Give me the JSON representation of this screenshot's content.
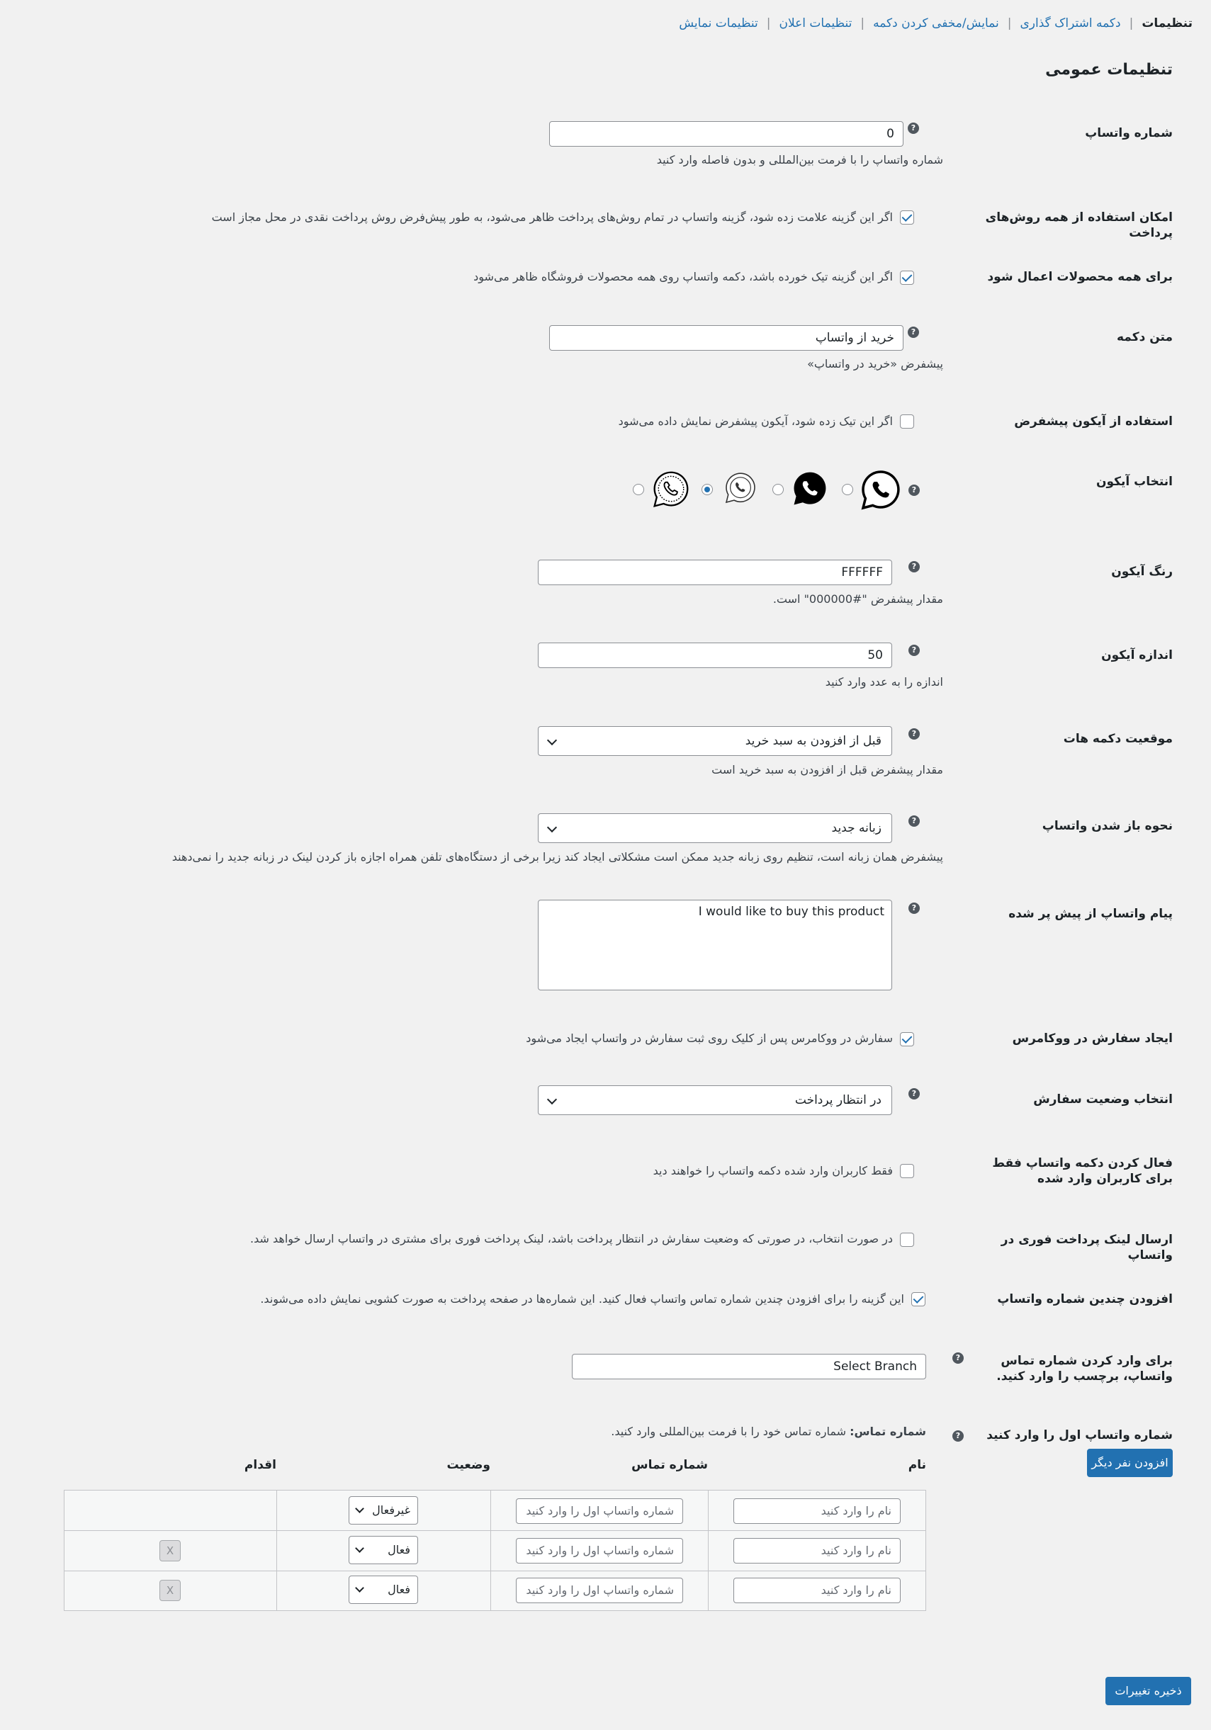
{
  "nav": {
    "current": "تنظیمات",
    "links": [
      "دکمه اشتراک گذاری",
      "نمایش/مخفی کردن دکمه",
      "تنظیمات اعلان",
      "تنظیمات نمایش"
    ]
  },
  "page_title": "تنظیمات عمومی",
  "help_glyph": "?",
  "fields": {
    "whatsapp_number": {
      "label": "شماره واتساپ",
      "value": "0",
      "desc": "شماره واتساپ را با فرمت بین‌المللی و بدون فاصله وارد کنید"
    },
    "all_payment_methods": {
      "label": "امکان استفاده از همه روش‌های پرداخت",
      "checked": true,
      "desc": "اگر این گزینه علامت زده شود، گزینه واتساپ در تمام روش‌های پرداخت ظاهر می‌شود، به طور پیش‌فرض روش پرداخت نقدی در محل مجاز است"
    },
    "all_products": {
      "label": "برای همه محصولات اعمال شود",
      "checked": true,
      "desc": "اگر این گزینه تیک خورده باشد، دکمه واتساپ روی همه محصولات فروشگاه ظاهر می‌شود"
    },
    "button_text": {
      "label": "متن دکمه",
      "value": "خرید از واتساپ",
      "desc": "پیشفرض «خرید در واتساپ»"
    },
    "default_icon": {
      "label": "استفاده از آیکون پیشفرض",
      "checked": false,
      "desc": "اگر این تیک زده شود، آیکون پیشفرض نمایش داده می‌شود"
    },
    "icon_select": {
      "label": "انتخاب آیکون",
      "icons": [
        "whatsapp-outline-icon",
        "whatsapp-solid-icon",
        "whatsapp-thin-icon",
        "whatsapp-dotted-icon"
      ],
      "selected_index": 2
    },
    "icon_color": {
      "label": "رنگ آیکون",
      "value": "FFFFFF",
      "desc": "مقدار پیشفرض \"#000000\" است."
    },
    "icon_size": {
      "label": "اندازه آیکون",
      "value": "50",
      "desc": "اندازه را به عدد وارد کنید"
    },
    "button_position": {
      "label": "موقعیت دکمه هات",
      "value": "قبل از افزودن به سبد خرید",
      "desc": "مقدار پیشفرض قبل از افزودن به سبد خرید است"
    },
    "open_mode": {
      "label": "نحوه باز شدن واتساپ",
      "value": "زبانه جدید",
      "desc": "پیشفرض همان زبانه است، تنظیم روی زبانه جدید ممکن است مشکلاتی ایجاد کند زیرا برخی از دستگاه‌های تلفن همراه اجازه باز کردن لینک در زبانه جدید را نمی‌دهند"
    },
    "prefilled_message": {
      "label": "پیام واتساپ از پیش پر شده",
      "value": "I would like to buy this product"
    },
    "create_order": {
      "label": "ایجاد سفارش در ووکامرس",
      "checked": true,
      "desc": "سفارش در ووکامرس پس از کلیک روی ثبت سفارش در واتساپ ایجاد می‌شود"
    },
    "order_status": {
      "label": "انتخاب وضعیت سفارش",
      "value": "در انتظار پرداخت"
    },
    "logged_in_only": {
      "label": "فعال کردن دکمه واتساپ فقط برای کاربران وارد شده",
      "checked": false,
      "desc": "فقط کاربران وارد شده دکمه واتساپ را خواهند دید"
    },
    "instant_payment_link": {
      "label": "ارسال لینک پرداخت فوری در واتساپ",
      "checked": false,
      "desc": "در صورت انتخاب، در صورتی که وضعیت سفارش در انتظار پرداخت باشد، لینک پرداخت فوری برای مشتری در واتساپ ارسال خواهد شد."
    },
    "multiple_numbers": {
      "label": "افزودن چندین شماره واتساپ",
      "checked": true,
      "desc": "این گزینه را برای افزودن چندین شماره تماس واتساپ فعال کنید. این شماره‌ها در صفحه پرداخت به صورت کشویی نمایش داده می‌شوند."
    },
    "branch_label": {
      "label": "برای وارد کردن شماره تماس واتساپ، برچسب را وارد کنید.",
      "value": "Select Branch"
    },
    "first_number": {
      "label": "شماره واتساپ اول را وارد کنید",
      "desc_bold": "شماره تماس:",
      "desc": " شماره تماس خود را با فرمت بین‌المللی وارد کنید."
    }
  },
  "add_person_button": "افزودن نفر دیگر",
  "table": {
    "headers": {
      "name": "نام",
      "phone": "شماره تماس",
      "status": "وضعیت",
      "action": "اقدام"
    },
    "rows": [
      {
        "name_placeholder": "نام را وارد کنید",
        "phone_placeholder": "شماره واتساپ اول را وارد کنید",
        "status": "غیرفعال",
        "remove": ""
      },
      {
        "name_placeholder": "نام را وارد کنید",
        "phone_placeholder": "شماره واتساپ اول را وارد کنید",
        "status": "فعال",
        "remove": "X"
      },
      {
        "name_placeholder": "نام را وارد کنید",
        "phone_placeholder": "شماره واتساپ اول را وارد کنید",
        "status": "فعال",
        "remove": "X"
      }
    ]
  },
  "save_button": "ذخیره تغییرات",
  "colors": {
    "accent": "#2271b1",
    "background": "#f1f1f1",
    "text": "#1d2327"
  }
}
